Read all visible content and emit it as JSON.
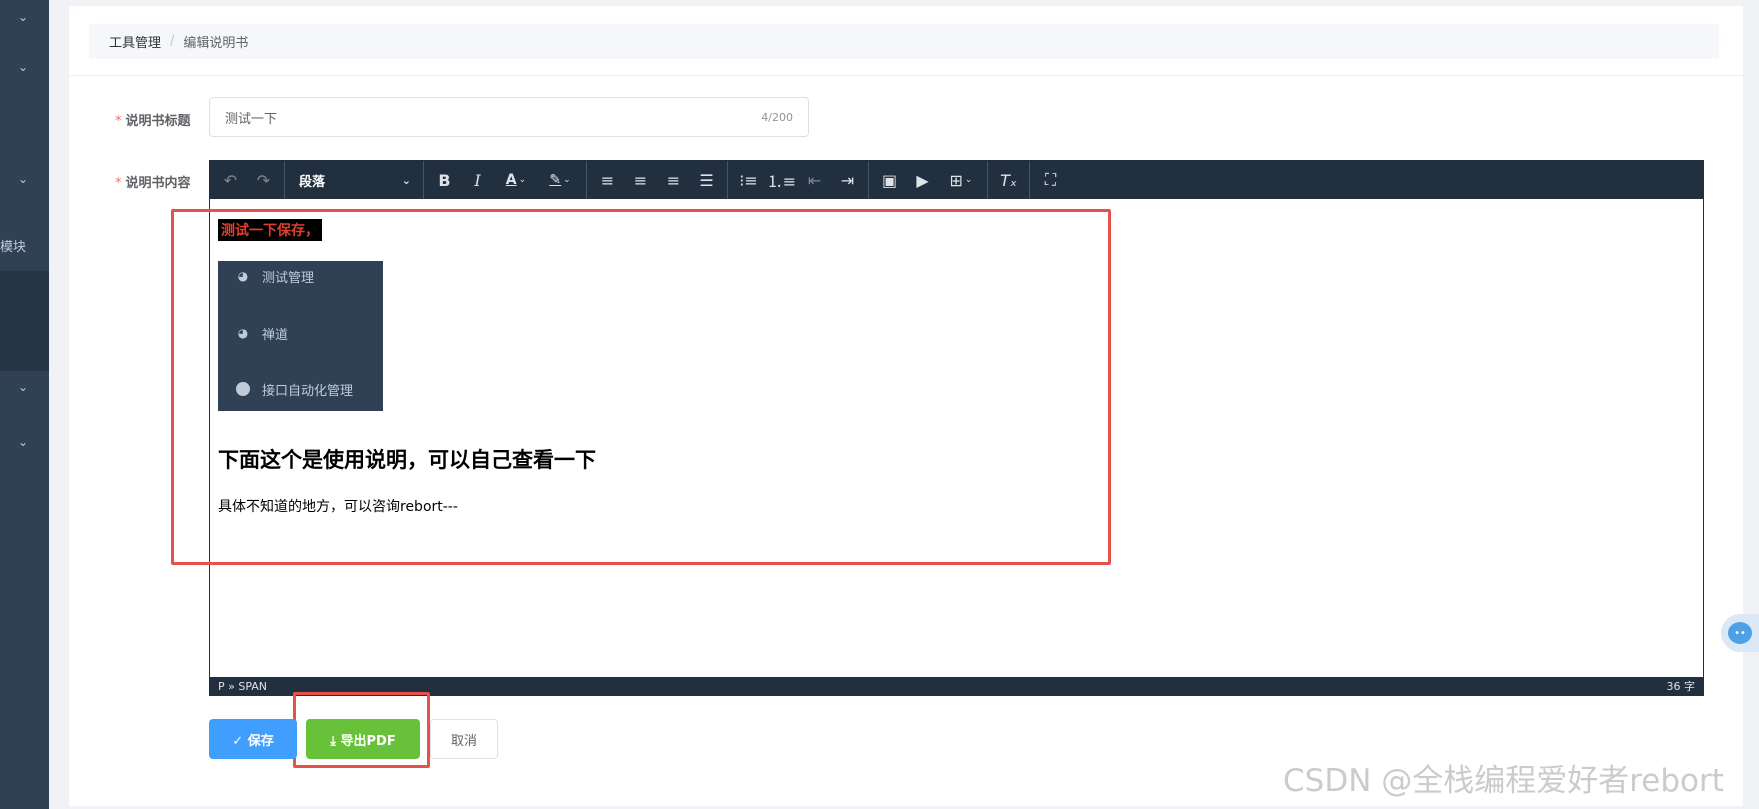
{
  "sidebar": {
    "module_label": "模块",
    "chevron": "⌄"
  },
  "breadcrumb": {
    "items": [
      "工具管理",
      "编辑说明书"
    ],
    "separator": "/"
  },
  "form": {
    "title_label": "说明书标题",
    "title_value": "测试一下",
    "title_counter": "4/200",
    "content_label": "说明书内容",
    "required_mark": "*"
  },
  "editor": {
    "block_format": "段落",
    "toolbar_icons": [
      "undo-icon",
      "redo-icon",
      "bold-icon",
      "italic-icon",
      "font-color-icon",
      "highlight-icon",
      "align-left-icon",
      "align-center-icon",
      "align-right-icon",
      "align-justify-icon",
      "bullet-list-icon",
      "numbered-list-icon",
      "outdent-icon",
      "indent-icon",
      "image-icon",
      "media-icon",
      "table-icon",
      "clear-format-icon",
      "fullscreen-icon"
    ],
    "highlighted_text": "测试一下保存，",
    "menu_items": [
      {
        "label": "测试管理",
        "icon": "dashboard-icon"
      },
      {
        "label": "禅道",
        "icon": "dashboard-icon"
      },
      {
        "label": "接口自动化管理",
        "icon": "circle-icon"
      }
    ],
    "heading": "下面这个是使用说明，可以自己查看一下",
    "paragraph": "具体不知道的地方，可以咨询rebort---",
    "status_path": "P » SPAN",
    "word_count": "36 字"
  },
  "buttons": {
    "save": "✓ 保存",
    "export_pdf": "⤓ 导出PDF",
    "cancel": "取消"
  },
  "watermark": "CSDN @全栈编程爱好者rebort",
  "colors": {
    "sidebar": "#304156",
    "primary": "#409eff",
    "success": "#67c23a",
    "annotation_red": "#e8514a",
    "highlight_text": "#e03e2d"
  }
}
